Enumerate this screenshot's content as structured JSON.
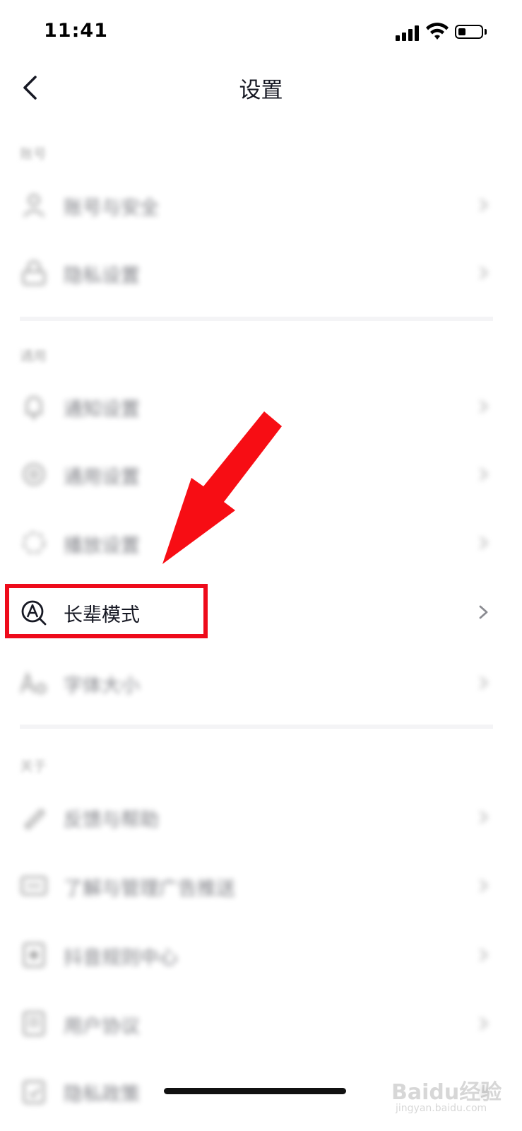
{
  "status_bar": {
    "time": "11:41"
  },
  "header": {
    "title": "设置"
  },
  "sections": [
    {
      "label": "账号",
      "items": [
        {
          "label": "账号与安全",
          "icon": "user-icon"
        },
        {
          "label": "隐私设置",
          "icon": "lock-icon"
        }
      ]
    },
    {
      "label": "通用",
      "items": [
        {
          "label": "通知设置",
          "icon": "bell-icon"
        },
        {
          "label": "通用设置",
          "icon": "gear-icon"
        },
        {
          "label": "播放设置",
          "icon": "play-settings-icon"
        },
        {
          "label": "长辈模式",
          "icon": "elder-mode-icon"
        },
        {
          "label": "字体大小",
          "icon": "font-size-icon"
        }
      ]
    },
    {
      "label": "关于",
      "items": [
        {
          "label": "反馈与帮助",
          "icon": "feedback-icon"
        },
        {
          "label": "了解与管理广告推送",
          "icon": "ad-icon"
        },
        {
          "label": "抖音规则中心",
          "icon": "rules-icon"
        },
        {
          "label": "用户协议",
          "icon": "agreement-icon"
        },
        {
          "label": "隐私政策",
          "icon": "privacy-policy-icon"
        }
      ]
    }
  ],
  "watermark": {
    "text": "Baidu经验",
    "url": "jingyan.baidu.com"
  },
  "colors": {
    "highlight": "#ee0b1b",
    "text": "#161823",
    "secondary": "#b0b0b0"
  }
}
